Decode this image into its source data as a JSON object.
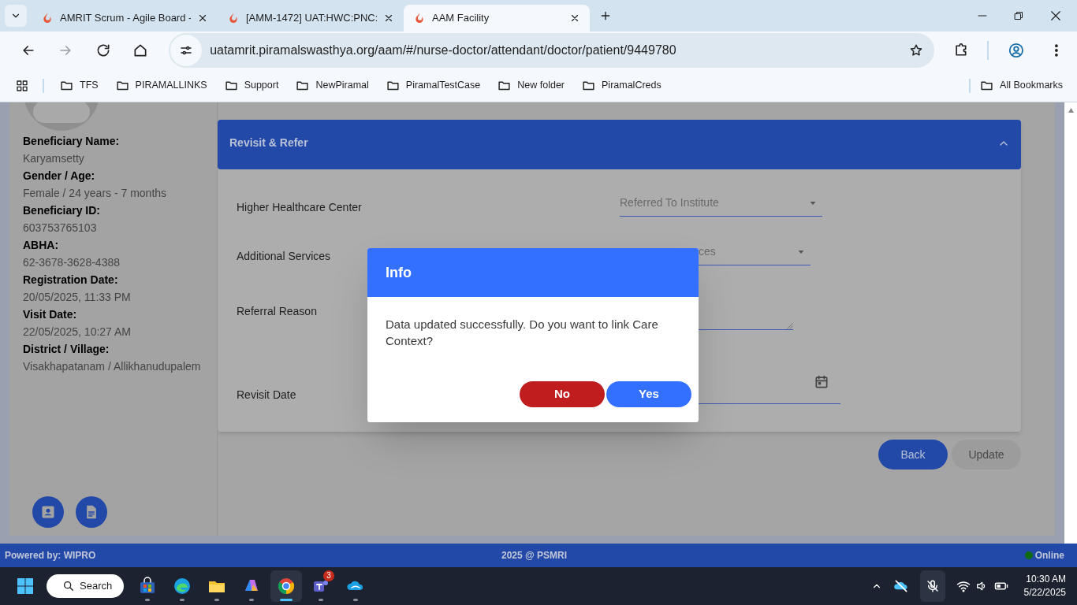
{
  "browser": {
    "tabs": [
      {
        "title": "AMRIT Scrum - Agile Board -",
        "selected": false
      },
      {
        "title": "[AMM-1472] UAT:HWC:PNC:",
        "selected": false
      },
      {
        "title": "AAM Facility",
        "selected": true
      }
    ],
    "url": "uatamrit.piramalswasthya.org/aam/#/nurse-doctor/attendant/doctor/patient/9449780",
    "bookmarks": [
      "TFS",
      "PIRAMALLINKS",
      "Support",
      "NewPiramal",
      "PiramalTestCase",
      "New folder",
      "PiramalCreds"
    ],
    "all_bookmarks": "All Bookmarks"
  },
  "sidebar": {
    "details": [
      {
        "label": "Beneficiary Name:",
        "value": "Karyamsetty"
      },
      {
        "label": "Gender / Age:",
        "value": "Female / 24 years - 7 months"
      },
      {
        "label": "Beneficiary ID:",
        "value": "603753765103"
      },
      {
        "label": "ABHA:",
        "value": "62-3678-3628-4388"
      },
      {
        "label": "Registration Date:",
        "value": "20/05/2025, 11:33 PM"
      },
      {
        "label": "Visit Date:",
        "value": "22/05/2025, 10:27 AM"
      },
      {
        "label": "District / Village:",
        "value": "Visakhapatanam / Allikhanudupalem"
      }
    ]
  },
  "section": {
    "title": "Revisit & Refer",
    "expanded": true,
    "rows": [
      {
        "label": "Higher Healthcare Center",
        "kind": "select",
        "placeholder": "Referred To Institute"
      },
      {
        "label": "Additional Services",
        "kind": "select",
        "placeholder": "ces"
      },
      {
        "label": "Referral Reason",
        "kind": "textarea"
      },
      {
        "label": "Revisit Date",
        "kind": "date"
      }
    ]
  },
  "actions": [
    {
      "label": "Back",
      "disabled": false
    },
    {
      "label": "Update",
      "disabled": true
    }
  ],
  "dialog": {
    "title": "Info",
    "message": "Data updated successfully. Do you want to link Care Context?",
    "buttons": [
      {
        "label": "No",
        "kind": "cancel"
      },
      {
        "label": "Yes",
        "kind": "confirm"
      }
    ]
  },
  "footer": {
    "left": "Powered by: WIPRO",
    "center": "2025 @ PSMRI",
    "status": "Online"
  },
  "taskbar": {
    "search": "Search",
    "apps": [
      {
        "kind": "store",
        "active": false
      },
      {
        "kind": "edge",
        "active": false
      },
      {
        "kind": "files",
        "active": false
      },
      {
        "kind": "m365",
        "active": false
      },
      {
        "kind": "chrome",
        "active": true
      },
      {
        "kind": "teams",
        "active": false,
        "badge": "3"
      },
      {
        "kind": "cloud",
        "active": false
      }
    ],
    "time": "10:30 AM",
    "date": "5/22/2025"
  }
}
